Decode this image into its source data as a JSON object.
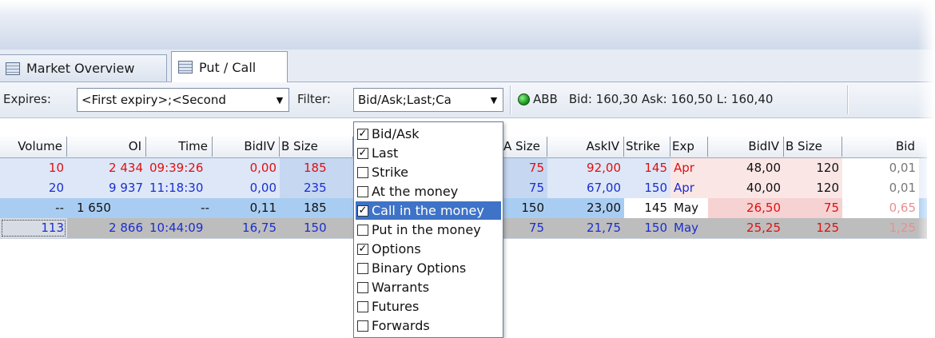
{
  "tabs": [
    {
      "label": "Market Overview",
      "active": false
    },
    {
      "label": "Put / Call",
      "active": true
    }
  ],
  "toolbar": {
    "expires_label": "Expires:",
    "expires_value": "<First expiry>;<Second",
    "filter_label": "Filter:",
    "filter_value": "Bid/Ask;Last;Ca",
    "ticker_symbol": "ABB",
    "ticker_quote": "Bid: 160,30  Ask: 160,50  L: 160,40"
  },
  "columns": [
    "Volume",
    "OI",
    "Time",
    "BidIV",
    "B Size",
    "A Size",
    "AskIV",
    "Strike",
    "Exp",
    "BidIV",
    "B Size",
    "Bid"
  ],
  "rows": [
    {
      "volume": "10",
      "oi": "2 434",
      "time": "09:39:26",
      "bidiv": "0,00",
      "bsize": "185",
      "asize": "75",
      "askiv": "92,00",
      "strike": "145",
      "exp": "Apr",
      "bidiv2": "48,00",
      "bsize2": "120",
      "bid2": "0,01"
    },
    {
      "volume": "20",
      "oi": "9 937",
      "time": "11:18:30",
      "bidiv": "0,00",
      "bsize": "235",
      "asize": "75",
      "askiv": "67,00",
      "strike": "150",
      "exp": "Apr",
      "bidiv2": "40,00",
      "bsize2": "120",
      "bid2": "0,01"
    },
    {
      "volume": "--",
      "oi": "1 650",
      "time": "--",
      "bidiv": "0,11",
      "bsize": "185",
      "asize": "150",
      "askiv": "23,00",
      "strike": "145",
      "exp": "May",
      "bidiv2": "26,50",
      "bsize2": "75",
      "bid2": "0,65"
    },
    {
      "volume": "113",
      "oi": "2 866",
      "time": "10:44:09",
      "bidiv": "16,75",
      "bsize": "150",
      "asize": "75",
      "askiv": "21,75",
      "strike": "150",
      "exp": "May",
      "bidiv2": "25,25",
      "bsize2": "125",
      "bid2": "1,25"
    }
  ],
  "filter_options": [
    {
      "label": "Bid/Ask",
      "checked": true,
      "selected": false
    },
    {
      "label": "Last",
      "checked": true,
      "selected": false
    },
    {
      "label": "Strike",
      "checked": false,
      "selected": false
    },
    {
      "label": "At the money",
      "checked": false,
      "selected": false
    },
    {
      "label": "Call in the money",
      "checked": true,
      "selected": true
    },
    {
      "label": "Put in the money",
      "checked": false,
      "selected": false
    },
    {
      "label": "Options",
      "checked": true,
      "selected": false
    },
    {
      "label": "Binary Options",
      "checked": false,
      "selected": false
    },
    {
      "label": "Warrants",
      "checked": false,
      "selected": false
    },
    {
      "label": "Futures",
      "checked": false,
      "selected": false
    },
    {
      "label": "Forwards",
      "checked": false,
      "selected": false
    }
  ],
  "colors": {
    "call_bg_light": "#dde7f7",
    "call_bg": "#c6d7f1",
    "selected_row": "#a9cdf2",
    "put_bg_light": "#fbe6e6",
    "put_bg": "#f6d2d2",
    "gray_row": "#bdbdbd",
    "text_red": "#e01010",
    "text_blue": "#1a2fd0",
    "accent": "#3e73c8"
  },
  "icons": {
    "tab_icon": "grid-table-icon",
    "status": "green-status-dot-icon",
    "dropdown": "chevron-down-icon",
    "check": "checkmark-icon"
  }
}
